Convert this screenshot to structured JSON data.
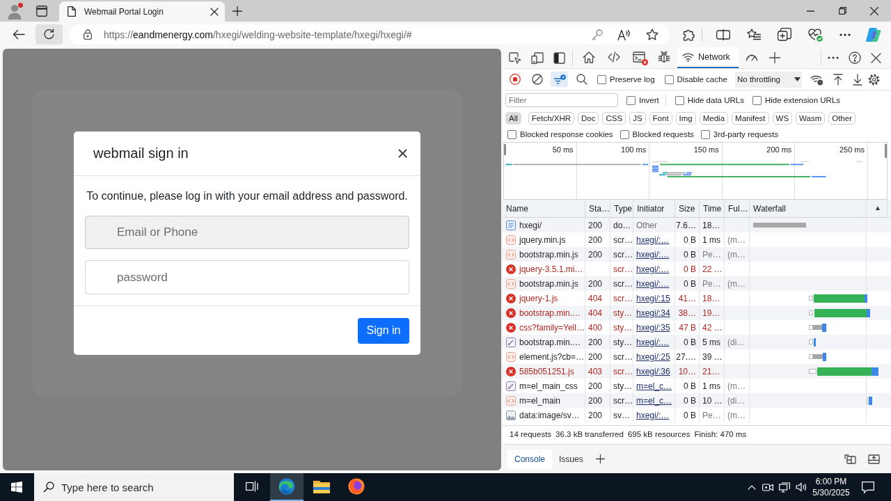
{
  "browser": {
    "profile": {
      "notification": true
    },
    "tabs": [
      {
        "title": "Webmail Portal Login",
        "selected": true
      }
    ],
    "address_bar": {
      "scheme": "https://",
      "host": "eandmenergy.com",
      "path": "/hxegi/welding-website-template/hxegi/hxegi/#"
    }
  },
  "page": {
    "modal": {
      "title": "webmail sign in",
      "message": "To continue, please log in with your email address and password.",
      "fields": [
        {
          "kind": "email",
          "placeholder": "Email or Phone"
        },
        {
          "kind": "password",
          "placeholder": "password"
        }
      ],
      "submit": "Sign in"
    }
  },
  "devtools": {
    "panel_tabs": [
      {
        "kind": "welcome",
        "selected": false,
        "has_errors": false
      },
      {
        "kind": "elements",
        "selected": false,
        "has_errors": false
      },
      {
        "kind": "console",
        "selected": false,
        "has_errors": true
      },
      {
        "kind": "sources",
        "selected": false,
        "has_errors": false
      },
      {
        "kind": "network",
        "label": "Network",
        "selected": true,
        "has_errors": false
      },
      {
        "kind": "performance",
        "selected": false,
        "has_errors": false
      }
    ],
    "toolbar": {
      "recording": true,
      "filter_active": true,
      "options": [
        {
          "label": "Preserve log",
          "checked": false
        },
        {
          "label": "Disable cache",
          "checked": false
        }
      ],
      "throttling": "No throttling"
    },
    "filter": {
      "placeholder": "Filter",
      "options": [
        {
          "label": "Invert",
          "checked": false
        },
        {
          "label": "Hide data URLs",
          "checked": false
        },
        {
          "label": "Hide extension URLs",
          "checked": false
        }
      ]
    },
    "type_filters": [
      {
        "label": "All",
        "selected": true
      },
      {
        "label": "Fetch/XHR",
        "selected": false
      },
      {
        "label": "Doc",
        "selected": false
      },
      {
        "label": "CSS",
        "selected": false
      },
      {
        "label": "JS",
        "selected": false
      },
      {
        "label": "Font",
        "selected": false
      },
      {
        "label": "Img",
        "selected": false
      },
      {
        "label": "Media",
        "selected": false
      },
      {
        "label": "Manifest",
        "selected": false
      },
      {
        "label": "WS",
        "selected": false
      },
      {
        "label": "Wasm",
        "selected": false
      },
      {
        "label": "Other",
        "selected": false
      }
    ],
    "blocked_options": [
      {
        "label": "Blocked response cookies",
        "checked": false
      },
      {
        "label": "Blocked requests",
        "checked": false
      },
      {
        "label": "3rd-party requests",
        "checked": false
      }
    ],
    "overview": {
      "ticks": [
        "50 ms",
        "100 ms",
        "150 ms",
        "200 ms",
        "250 ms"
      ]
    },
    "table": {
      "columns": [
        {
          "label": "Name"
        },
        {
          "label": "Sta…"
        },
        {
          "label": "Type"
        },
        {
          "label": "Initiator"
        },
        {
          "label": "Size"
        },
        {
          "label": "Time"
        },
        {
          "label": "Ful…"
        },
        {
          "label": "Waterfall",
          "sort_indicator": "▲"
        }
      ],
      "rows": [
        {
          "kind": "document",
          "name": "hxegi/",
          "status": "200",
          "type": "do…",
          "initiator": {
            "text": "Other",
            "link": false
          },
          "size": "7.6…",
          "time": "18…",
          "pending": false
        },
        {
          "kind": "script",
          "name": "jquery.min.js",
          "status": "200",
          "type": "scr…",
          "initiator": {
            "text": "hxegi/:…",
            "link": true
          },
          "size": "0 B",
          "time": "1 ms",
          "pending": false,
          "fulfilled": "(m…"
        },
        {
          "kind": "script",
          "name": "bootstrap.min.js",
          "status": "200",
          "type": "scr…",
          "initiator": {
            "text": "hxegi/:…",
            "link": true
          },
          "size": "0 B",
          "time": "Pe…",
          "pending": true,
          "fulfilled": "(m…"
        },
        {
          "kind": "error",
          "name": "jquery-3.5.1.mi…",
          "type": "scr…",
          "initiator": {
            "text": "hxegi/:…",
            "link": true
          },
          "size": "0 B",
          "time": "22 …",
          "pending": false
        },
        {
          "kind": "script",
          "name": "bootstrap.min.js",
          "status": "200",
          "type": "scr…",
          "initiator": {
            "text": "hxegi/:…",
            "link": true
          },
          "size": "0 B",
          "time": "Pe…",
          "pending": true,
          "fulfilled": "(m…"
        },
        {
          "kind": "error",
          "name": "jquery-1.js",
          "status": "404",
          "type": "scr…",
          "initiator": {
            "text": "hxegi/:15",
            "link": true
          },
          "size": "41…",
          "time": "18…",
          "pending": false
        },
        {
          "kind": "error",
          "name": "bootstrap.min.…",
          "status": "404",
          "type": "sty…",
          "initiator": {
            "text": "hxegi/:34",
            "link": true
          },
          "size": "38…",
          "time": "19…",
          "pending": false
        },
        {
          "kind": "error",
          "name": "css?family=Yell…",
          "status": "400",
          "type": "sty…",
          "initiator": {
            "text": "hxegi/:35",
            "link": true
          },
          "size": "47 B",
          "time": "42 …",
          "pending": false
        },
        {
          "kind": "stylesheet",
          "name": "bootstrap.min.…",
          "status": "200",
          "type": "sty…",
          "initiator": {
            "text": "hxegi/:…",
            "link": true
          },
          "size": "0 B",
          "time": "5 ms",
          "pending": false,
          "fulfilled": "(di…"
        },
        {
          "kind": "script",
          "name": "element.js?cb=…",
          "status": "200",
          "type": "scr…",
          "initiator": {
            "text": "hxegi/:25",
            "link": true
          },
          "size": "27.…",
          "time": "39 …",
          "pending": false
        },
        {
          "kind": "error",
          "name": "585b051251.js",
          "status": "403",
          "type": "scr…",
          "initiator": {
            "text": "hxegi/:36",
            "link": true
          },
          "size": "10…",
          "time": "21…",
          "pending": false
        },
        {
          "kind": "stylesheet",
          "name": "m=el_main_css",
          "status": "200",
          "type": "sty…",
          "initiator": {
            "text": "m=el_c…",
            "link": true
          },
          "size": "0 B",
          "time": "1 ms",
          "pending": false,
          "fulfilled": "(m…"
        },
        {
          "kind": "script",
          "name": "m=el_main",
          "status": "200",
          "type": "scr…",
          "initiator": {
            "text": "m=el_c…",
            "link": true
          },
          "size": "0 B",
          "time": "10 …",
          "pending": false,
          "fulfilled": "(di…"
        },
        {
          "kind": "image",
          "name": "data:image/sv…",
          "status": "200",
          "type": "sv…",
          "initiator": {
            "text": "hxegi/:…",
            "link": true
          },
          "size": "0 B",
          "time": "Pe…",
          "pending": true,
          "fulfilled": "(m…"
        }
      ]
    },
    "status_bar": [
      "14 requests",
      "36.3 kB transferred",
      "695 kB resources",
      "Finish: 470 ms"
    ],
    "drawer_tabs": [
      {
        "label": "Console",
        "selected": true
      },
      {
        "label": "Issues",
        "selected": false
      }
    ]
  },
  "taskbar": {
    "search_placeholder": "Type here to search",
    "buttons": [
      {
        "kind": "task_view",
        "active": false
      },
      {
        "kind": "edge",
        "active": true
      },
      {
        "kind": "explorer",
        "active": false
      },
      {
        "kind": "firefox",
        "active": false
      }
    ],
    "time": "6:00 PM",
    "date": "5/30/2025"
  }
}
